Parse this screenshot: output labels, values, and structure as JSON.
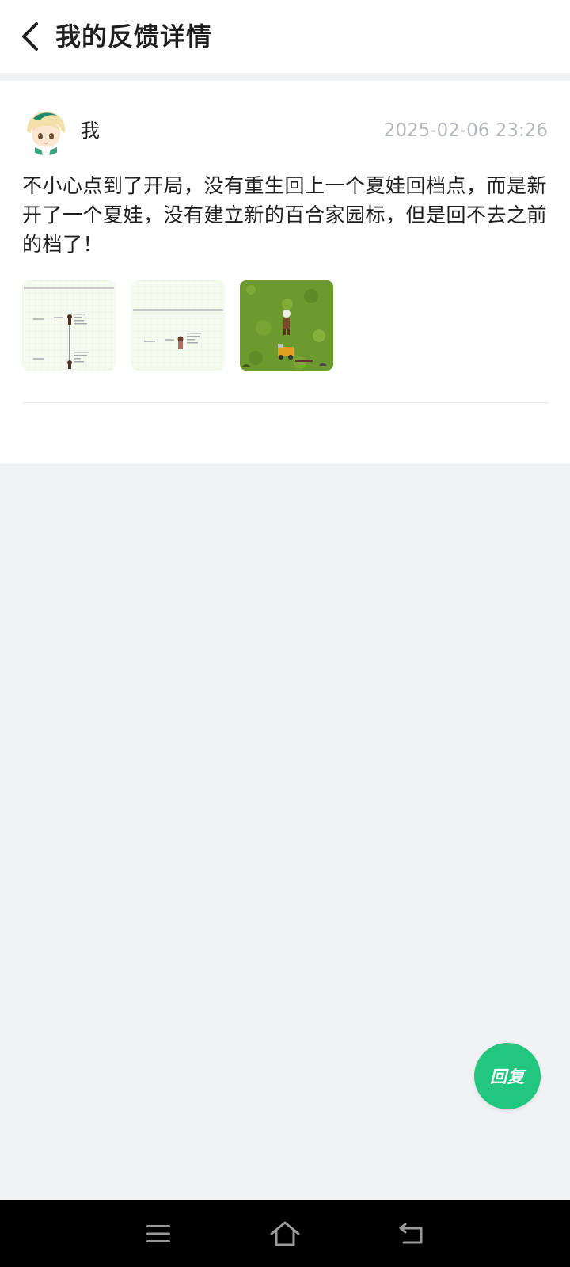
{
  "header": {
    "title": "我的反馈详情",
    "back_icon": "chevron-left-icon"
  },
  "feedback": {
    "author": "我",
    "timestamp": "2025-02-06 23:26",
    "message": "不小心点到了开局，没有重生回上一个夏娃回档点，而是新开了一个夏娃，没有建立新的百合家园标，但是回不去之前的档了！",
    "attachments": [
      {
        "kind": "family-tree-screenshot"
      },
      {
        "kind": "family-tree-screenshot"
      },
      {
        "kind": "game-field-screenshot"
      }
    ]
  },
  "reply_button": {
    "label": "回复",
    "color": "#22c67f"
  },
  "navbar": {
    "items": [
      "menu-icon",
      "home-icon",
      "back-icon"
    ]
  }
}
